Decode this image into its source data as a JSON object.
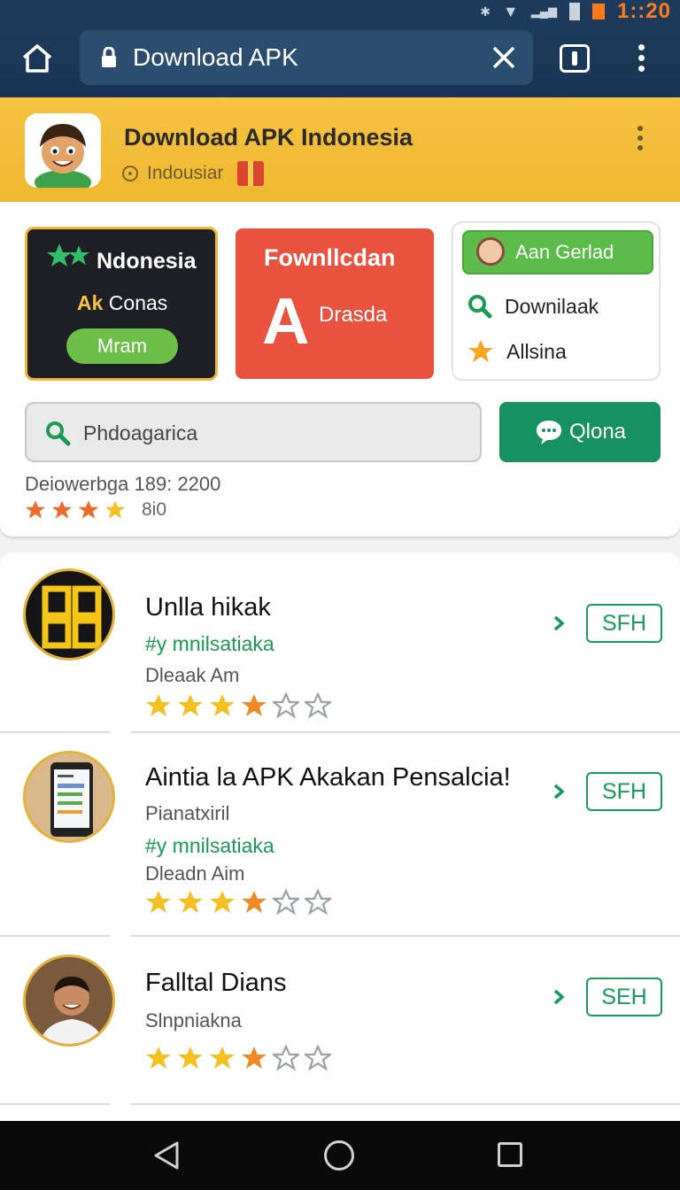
{
  "status_bar": {
    "time": "1::20"
  },
  "browser": {
    "url_text": "Download APK"
  },
  "site_header": {
    "title": "Download APK Indonesia",
    "subtitle": "Indousiar"
  },
  "cards": {
    "dark": {
      "title": "Ndonesia",
      "line_accent": "Ak",
      "line_text": "Conas",
      "button": "Mram"
    },
    "red": {
      "title": "Fownllcdan",
      "big_letter": "A",
      "subtitle": "Drasda"
    },
    "list": {
      "top_label": "Aan Gerlad",
      "items": [
        "Downilaak",
        "Allsina"
      ]
    }
  },
  "search": {
    "placeholder": "Phdoagarica",
    "action_label": "Qlona"
  },
  "meta": {
    "line": "Deiowerbga 189: 2200",
    "rating_value": "8.0",
    "rating_text": "8i0",
    "stars_filled": 4
  },
  "items": [
    {
      "title": "Unlla hikak",
      "tag": "#y mnilsatiaka",
      "line": "Dleaak Am",
      "rating": 3.5,
      "action": "SFH"
    },
    {
      "title": "Aintia la APK Akakan Pensalcia!",
      "line_top": "Pianatxiril",
      "tag": "#y mnilsatiaka",
      "line": "Dleadn Aim",
      "rating": 3.5,
      "action": "SFH"
    },
    {
      "title": "Falltal Dians",
      "line": "Slnpniakna",
      "rating": 3.5,
      "action": "SEH"
    }
  ],
  "colors": {
    "accent_yellow": "#f0b830",
    "brand_green": "#17915f",
    "red_card": "#e8523f",
    "chrome_blue": "#1d3c5c"
  },
  "icons": [
    "home-icon",
    "lock-icon",
    "close-icon",
    "tabs-icon",
    "more-icon",
    "search-icon",
    "chat-icon",
    "star-icon",
    "chevron-right-icon",
    "back-icon",
    "home-nav-icon",
    "recent-apps-icon"
  ]
}
